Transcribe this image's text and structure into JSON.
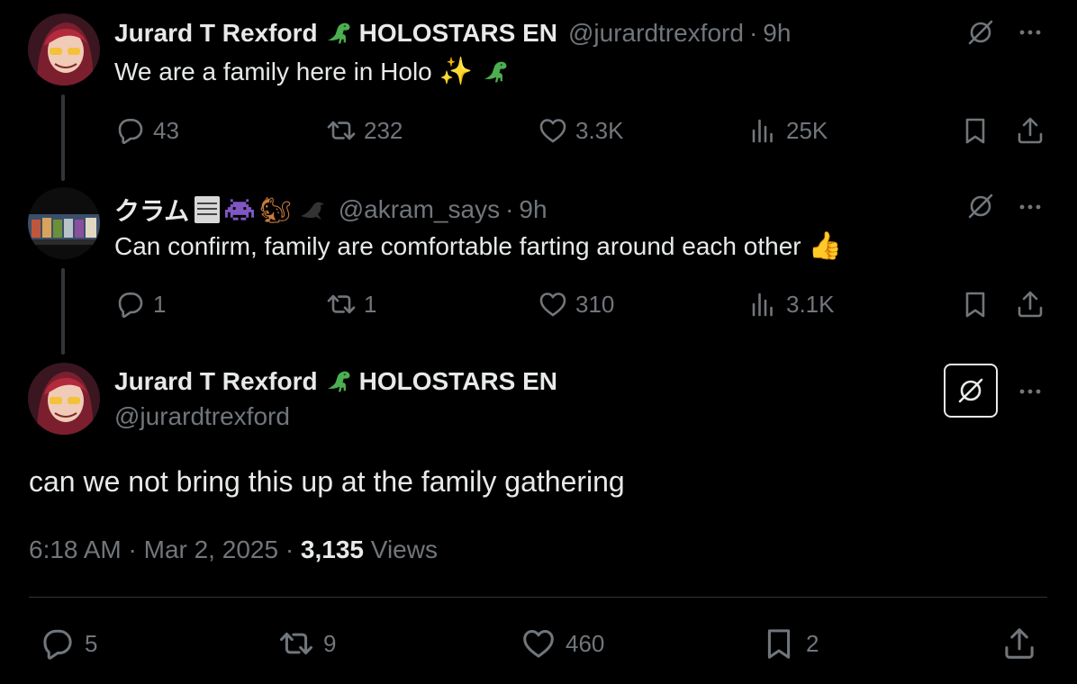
{
  "tweet1": {
    "display_name": "Jurard T Rexford",
    "name_suffix": "HOLOSTARS EN",
    "handle": "@jurardtrexford",
    "time": "9h",
    "text": "We are a family here in Holo",
    "metrics": {
      "replies": "43",
      "retweets": "232",
      "likes": "3.3K",
      "views": "25K"
    }
  },
  "tweet2": {
    "display_name": "クラム",
    "handle": "@akram_says",
    "time": "9h",
    "text": "Can confirm, family are comfortable farting around each other",
    "metrics": {
      "replies": "1",
      "retweets": "1",
      "likes": "310",
      "views": "3.1K"
    }
  },
  "main_tweet": {
    "display_name": "Jurard T Rexford",
    "name_suffix": "HOLOSTARS EN",
    "handle": "@jurardtrexford",
    "text": "can we not bring this up at the family gathering",
    "timestamp": "6:18 AM · Mar 2, 2025 · ",
    "views_count": "3,135",
    "views_label": " Views",
    "metrics": {
      "replies": "5",
      "retweets": "9",
      "likes": "460",
      "bookmarks": "2"
    }
  },
  "icons": {
    "reply": "reply-icon",
    "retweet": "retweet-icon",
    "like": "heart-icon",
    "views": "views-icon",
    "bookmark": "bookmark-icon",
    "share": "share-icon",
    "grok": "grok-icon",
    "more": "more-icon"
  }
}
